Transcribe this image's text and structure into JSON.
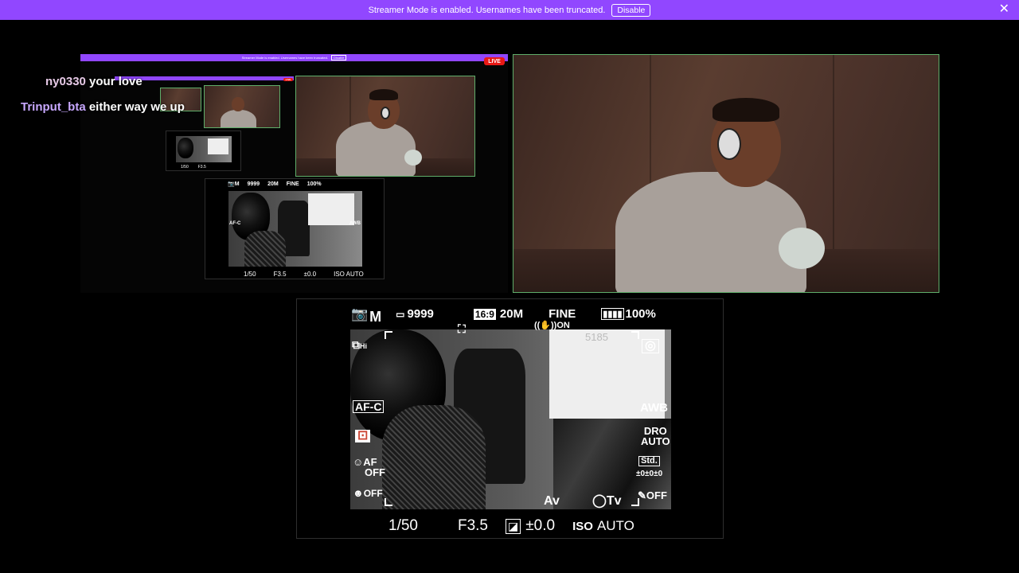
{
  "banner": {
    "message": "Streamer Mode is enabled. Usernames have been truncated.",
    "disable_label": "Disable",
    "close_icon": "close-icon",
    "color": "#9147ff"
  },
  "nested": {
    "live_label": "LIVE"
  },
  "chat": [
    {
      "user": "ny0330",
      "message": "your love"
    },
    {
      "user": "Trinput_bta",
      "message": "either way we up"
    }
  ],
  "viewfinder": {
    "mode": "M",
    "mode_icon": "camera-icon",
    "battery_shots": "9999",
    "aspect": "16:9",
    "megapixels": "20M",
    "quality": "FINE",
    "battery_percent": "100%",
    "steady_label": "ON",
    "drive_label": "Hi",
    "focus_mode": "AF-C",
    "face_af": "AF",
    "face_af_state": "OFF",
    "smile_state": "OFF",
    "awb": "AWB",
    "dro": "DRO",
    "dro_state": "AUTO",
    "style": "Std.",
    "style_values": "±0±0±0",
    "av": "Av",
    "tv": "Tv",
    "picture_effect_state": "OFF",
    "shutter": "1/50",
    "aperture": "F3.5",
    "exposure_comp": "±0.0",
    "iso_label": "ISO",
    "iso_value": "AUTO"
  },
  "whiteboard_text": "5185"
}
